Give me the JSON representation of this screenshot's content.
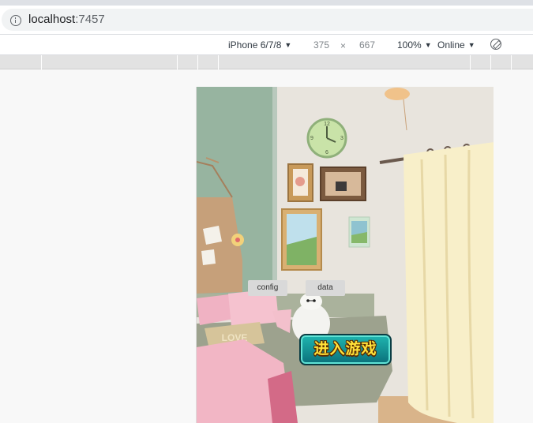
{
  "browser": {
    "url_host": "localhost",
    "url_port": ":7457"
  },
  "device_toolbar": {
    "device": "iPhone 6/7/8",
    "width": "375",
    "times": "×",
    "height": "667",
    "zoom": "100%",
    "network": "Online",
    "caret": "▼"
  },
  "game": {
    "config_label": "config",
    "data_label": "data",
    "start_label": "进入游戏",
    "pillow_text": "LOVE",
    "clock_numerals": [
      "12",
      "3",
      "6",
      "9"
    ]
  },
  "colors": {
    "wall_green": "#97b4a0",
    "wall_cream": "#e8e4dd",
    "curtain": "#f8efc9",
    "bed_pink": "#f2b6c5",
    "button_teal": "#118d94",
    "button_text": "#ffe23a"
  }
}
